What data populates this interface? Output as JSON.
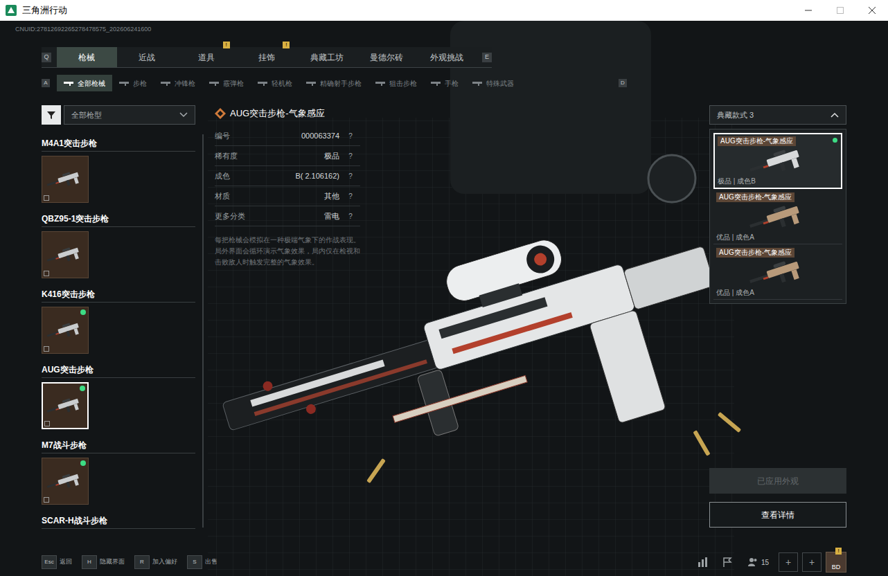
{
  "window": {
    "title": "三角洲行动"
  },
  "uid": "CNUID:27812692265278478575_202606241600",
  "tabs": {
    "prev_key": "Q",
    "next_key": "E",
    "items": [
      {
        "label": "枪械",
        "selected": true,
        "badge": ""
      },
      {
        "label": "近战",
        "selected": false,
        "badge": ""
      },
      {
        "label": "道具",
        "selected": false,
        "badge": "!"
      },
      {
        "label": "挂饰",
        "selected": false,
        "badge": "!"
      },
      {
        "label": "典藏工坊",
        "selected": false,
        "badge": ""
      },
      {
        "label": "曼德尔砖",
        "selected": false,
        "badge": ""
      },
      {
        "label": "外观挑战",
        "selected": false,
        "badge": ""
      }
    ]
  },
  "subtabs": {
    "prev_key": "A",
    "next_key": "D",
    "items": [
      {
        "label": "全部枪械",
        "selected": true
      },
      {
        "label": "步枪",
        "selected": false
      },
      {
        "label": "冲锋枪",
        "selected": false
      },
      {
        "label": "霰弹枪",
        "selected": false
      },
      {
        "label": "轻机枪",
        "selected": false
      },
      {
        "label": "精确射手步枪",
        "selected": false
      },
      {
        "label": "狙击步枪",
        "selected": false
      },
      {
        "label": "手枪",
        "selected": false
      },
      {
        "label": "特殊武器",
        "selected": false
      }
    ]
  },
  "filter": {
    "value": "全部枪型"
  },
  "weapons": [
    {
      "name": "M4A1突击步枪",
      "selected": false,
      "equipped": false,
      "kind": "full"
    },
    {
      "name": "QBZ95-1突击步枪",
      "selected": false,
      "equipped": false,
      "kind": "full"
    },
    {
      "name": "K416突击步枪",
      "selected": false,
      "equipped": true,
      "kind": "full"
    },
    {
      "name": "AUG突击步枪",
      "selected": true,
      "equipped": true,
      "kind": "full"
    },
    {
      "name": "M7战斗步枪",
      "selected": false,
      "equipped": true,
      "kind": "full"
    },
    {
      "name": "SCAR-H战斗步枪",
      "selected": false,
      "equipped": false,
      "kind": "label"
    }
  ],
  "detail": {
    "title": "AUG突击步枪-气象感应",
    "rows": [
      {
        "label": "编号",
        "value": "000063374",
        "help": "?"
      },
      {
        "label": "稀有度",
        "value": "极品",
        "help": "?"
      },
      {
        "label": "成色",
        "value": "B( 2.106162)",
        "help": "?"
      },
      {
        "label": "材质",
        "value": "其他",
        "help": "?"
      },
      {
        "label": "更多分类",
        "value": "雷电",
        "help": "?"
      }
    ],
    "description": "每把枪械会模拟在一种极端气象下的作战表现。局外界面会循环演示气象效果，局内仅在检视和击败敌人时触发完整的气象效果。"
  },
  "style_dropdown": {
    "label": "典藏款式 3",
    "expanded": true,
    "options": [
      {
        "name": "AUG突击步枪-气象感应",
        "grade": "极品 | 成色B",
        "selected": true,
        "equipped": true
      },
      {
        "name": "AUG突击步枪-气象感应",
        "grade": "优品 | 成色A",
        "selected": false,
        "equipped": false
      },
      {
        "name": "AUG突击步枪-气象感应",
        "grade": "优品 | 成色A",
        "selected": false,
        "equipped": false
      }
    ]
  },
  "buttons": [
    {
      "label": "已应用外观",
      "disabled": true
    },
    {
      "label": "查看详情",
      "disabled": false
    }
  ],
  "hints": [
    {
      "key": "Esc",
      "label": "返回"
    },
    {
      "key": "H",
      "label": "隐藏界面"
    },
    {
      "key": "R",
      "label": "加入偏好"
    },
    {
      "key": "S",
      "label": "出售"
    }
  ],
  "status": {
    "friends": "15",
    "add": [
      "+",
      "+"
    ],
    "avatar": "BD",
    "badge": "!"
  }
}
